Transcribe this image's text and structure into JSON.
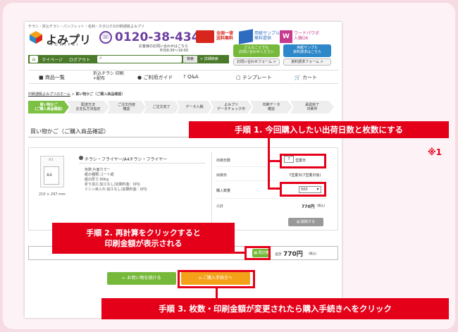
{
  "header": {
    "tagline": "チラシ・折込チラシ・パンフレット・名刺・カタログの印刷通販よみプリ",
    "logo_text": "よみプリ",
    "logo_sub": "YOMIPRI",
    "phone": "0120-38-4343",
    "hours_line1": "お客様のお問い合わせはこちら",
    "hours_line2": "平日9:30〜19:00",
    "free_shipping_line1": "全国一律",
    "free_shipping_line2": "送料無料",
    "sample_line1": "用紙サンプル",
    "sample_line2": "無料提供",
    "word_line1": "ワードパワポ",
    "word_line2": "入稿OK"
  },
  "nav": {
    "mypage": "マイページ",
    "logout": "ログアウト",
    "search_button": "検索",
    "detail_search": "> 詳細検索",
    "contact_title1": "どんなことでも",
    "contact_title2": "お問い合わせください",
    "contact_form": "お問い合わせフォーム >",
    "sample_title1": "用紙サンプル",
    "sample_title2": "資料請求はこちら",
    "sample_form": "資料請求フォーム >"
  },
  "menu": [
    "商品一覧",
    "折込チラシ 印刷+配布",
    "ご利用ガイド",
    "Q&A",
    "テンプレート",
    "カート"
  ],
  "breadcrumb": {
    "home": "印刷通販よみプリのホーム",
    "sep": " > ",
    "current": "買い物かご（ご購入商品確認）"
  },
  "steps": [
    {
      "l1": "買い物かご",
      "l2": "(ご購入商品確認)"
    },
    {
      "l1": "配送方法",
      "l2": "お支払方法指定"
    },
    {
      "l1": "ご注文内容",
      "l2": "確認"
    },
    {
      "l1": "ご注文完了",
      "l2": ""
    },
    {
      "l1": "データ入稿",
      "l2": ""
    },
    {
      "l1": "よみプリ",
      "l2": "データチェック中"
    },
    {
      "l1": "印刷データ",
      "l2": "確認"
    },
    {
      "l1": "承認完了",
      "l2": "印刷中"
    }
  ],
  "section_title": "買い物かご（ご購入商品確認）",
  "product": {
    "thumb_a3": "A3",
    "thumb_a4": "A4",
    "thumb_size": "210 × 297 mm",
    "title": "チラシ・フライヤー/A4チラシ・フライヤー",
    "specs": [
      "色数:片面カラー",
      "紙の種類:コート紙",
      "紙の厚さ:90kg",
      "折り加工:加工なし(加算料金：0円)",
      "ミシン目入れ:加工なし(加算料金：0円)"
    ]
  },
  "order": {
    "ship_days_label": "出荷日数",
    "ship_days_value": "7",
    "ship_days_suffix": "営業日",
    "ship_date_label": "出荷日",
    "ship_date_value": "7営業日(7営業日後)",
    "qty_label": "購入数量",
    "qty_value": "500",
    "subtotal_label": "小計",
    "subtotal_value": "770円",
    "subtotal_tax": "(税込)",
    "delete_button": "削除する"
  },
  "total": {
    "recalc_button": "再計算",
    "label": "合計",
    "value": "770円",
    "tax": "(税込)"
  },
  "buttons": {
    "back": "お買い物を続ける",
    "proceed": "ご購入手続きへ"
  },
  "callouts": {
    "step1": "手順 1. 今回購入したい出荷日数と枚数にする",
    "note": "※1",
    "step2_line1": "手順 2. 再計算をクリックすると",
    "step2_line2": "印刷金額が表示される",
    "step3": "手順 3. 枚数・印刷金額が変更されたら購入手続きへをクリック"
  },
  "colors": {
    "accent_green": "#76b93a",
    "callout_red": "#e5001a",
    "proceed_orange": "#f4a11a",
    "brand_purple": "#6c3fa0"
  }
}
